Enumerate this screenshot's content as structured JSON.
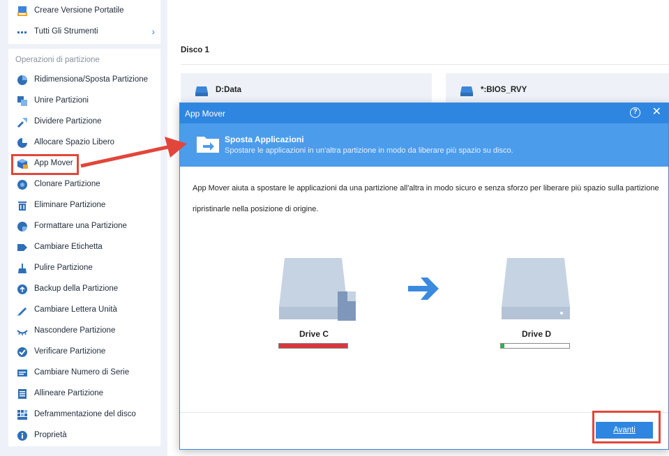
{
  "sidebar": {
    "top_items": [
      {
        "label": "Creare Versione Portatile",
        "icon": "portable-icon"
      },
      {
        "label": "Tutti Gli Strumenti",
        "icon": "more-icon"
      }
    ],
    "section_title": "Operazioni di partizione",
    "items": [
      {
        "label": "Ridimensiona/Sposta Partizione",
        "icon": "resize-icon"
      },
      {
        "label": "Unire Partizioni",
        "icon": "merge-icon"
      },
      {
        "label": "Dividere Partizione",
        "icon": "split-icon"
      },
      {
        "label": "Allocare Spazio Libero",
        "icon": "allocate-icon"
      },
      {
        "label": "App Mover",
        "icon": "app-mover-icon"
      },
      {
        "label": "Clonare Partizione",
        "icon": "clone-icon"
      },
      {
        "label": "Eliminare Partizione",
        "icon": "delete-icon"
      },
      {
        "label": "Formattare una Partizione",
        "icon": "format-icon"
      },
      {
        "label": "Cambiare Etichetta",
        "icon": "label-icon"
      },
      {
        "label": "Pulire Partizione",
        "icon": "wipe-icon"
      },
      {
        "label": "Backup della Partizione",
        "icon": "backup-icon"
      },
      {
        "label": "Cambiare Lettera Unità",
        "icon": "drive-letter-icon"
      },
      {
        "label": "Nascondere Partizione",
        "icon": "hide-icon"
      },
      {
        "label": "Verificare Partizione",
        "icon": "check-icon"
      },
      {
        "label": "Cambiare Numero di Serie",
        "icon": "serial-icon"
      },
      {
        "label": "Allineare Partizione",
        "icon": "align-icon"
      },
      {
        "label": "Deframmentazione del disco",
        "icon": "defrag-icon"
      },
      {
        "label": "Proprietà",
        "icon": "info-icon"
      }
    ]
  },
  "main": {
    "disk_title": "Disco 1",
    "partitions": [
      {
        "name": "D:Data"
      },
      {
        "name": "*:BIOS_RVY"
      }
    ]
  },
  "dialog": {
    "title": "App Mover",
    "banner_title": "Sposta Applicazioni",
    "banner_subtitle": "Spostare le applicazioni in un'altra partizione in modo da liberare più spazio su disco.",
    "description_line1": "App Mover aiuta a spostare le applicazioni da una partizione all'altra in modo sicuro e senza sforzo per liberare più spazio sulla partizione origina",
    "description_line2": "ripristinarle nella posizione di origine.",
    "source_drive": {
      "label": "Drive C",
      "usage_fraction": 1.0,
      "color": "#d9363e"
    },
    "target_drive": {
      "label": "Drive D",
      "usage_fraction": 0.05,
      "color": "#2fb24a"
    },
    "next_button": "Avanti"
  },
  "colors": {
    "accent": "#2f86e0",
    "banner": "#4c9cec",
    "highlight": "#e2463b"
  }
}
